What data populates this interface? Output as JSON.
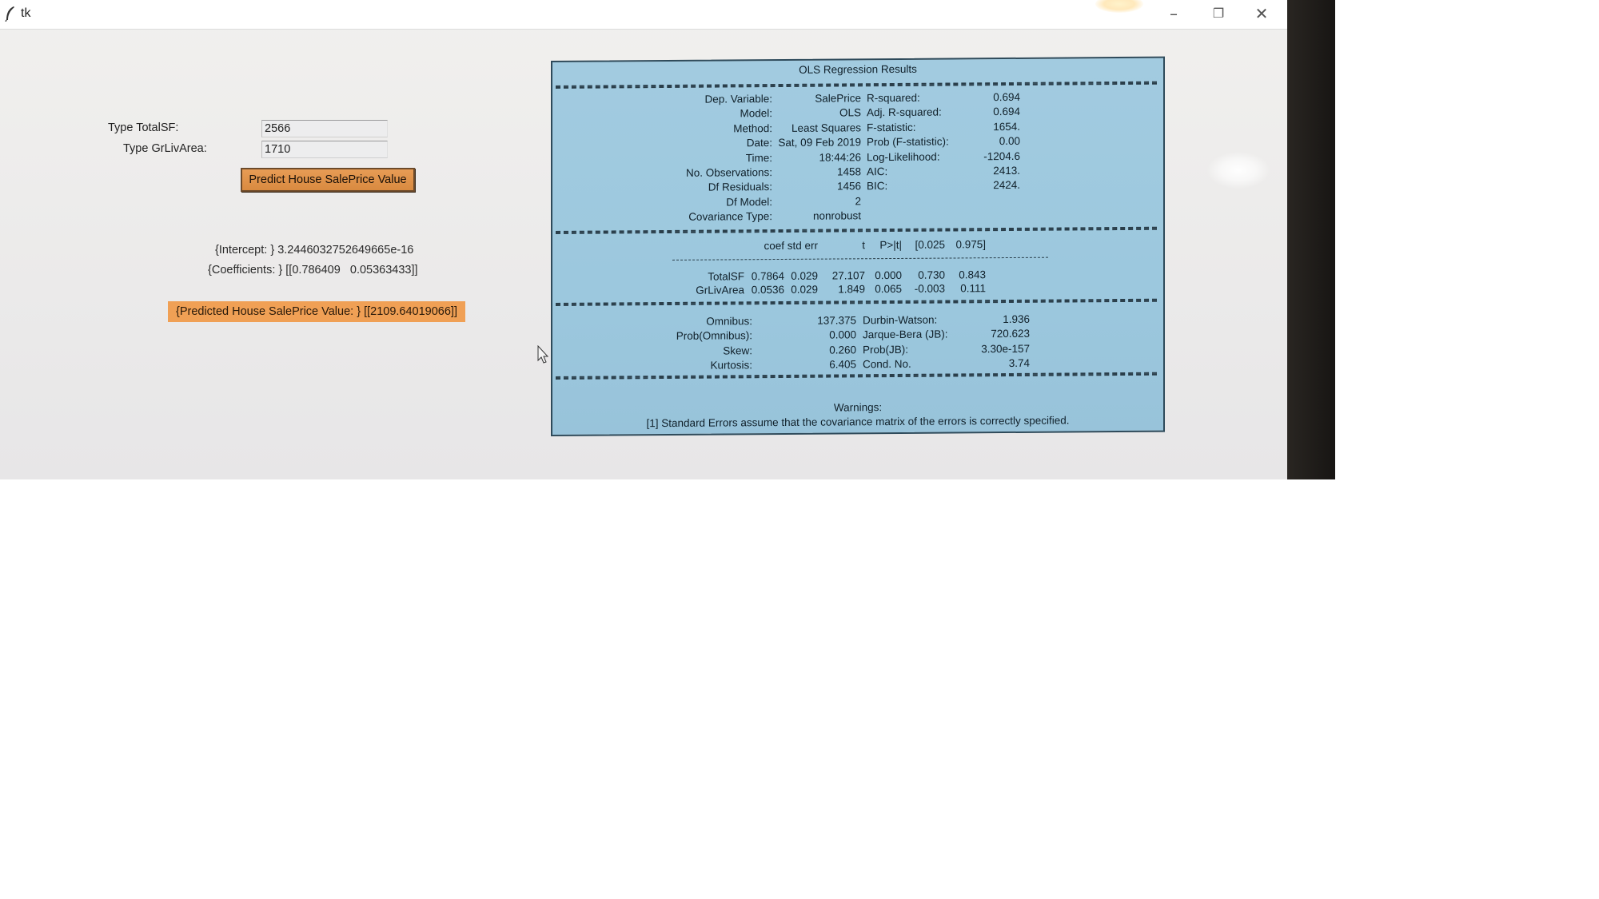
{
  "window": {
    "title": "tk",
    "minimize": "–",
    "restore": "❐",
    "close": "✕"
  },
  "form": {
    "totalsf_label": "Type TotalSF:",
    "totalsf_value": "2566",
    "grlivarea_label": "Type GrLivArea:",
    "grlivarea_value": "1710",
    "predict_button": "Predict House SalePrice Value"
  },
  "results": {
    "intercept": "{Intercept: } 3.2446032752649665e-16",
    "coefficients": "{Coefficients: } [[0.786409   0.05363433]]",
    "predicted": "{Predicted House SalePrice Value: } [[2109.64019066]]"
  },
  "ols": {
    "title": "OLS Regression Results",
    "header_rows": [
      {
        "l": "Dep. Variable:",
        "lv": "SalePrice",
        "r": "R-squared:",
        "rv": "0.694"
      },
      {
        "l": "Model:",
        "lv": "OLS",
        "r": "Adj. R-squared:",
        "rv": "0.694"
      },
      {
        "l": "Method:",
        "lv": "Least Squares",
        "r": "F-statistic:",
        "rv": "1654."
      },
      {
        "l": "Date:",
        "lv": "Sat, 09 Feb 2019",
        "r": "Prob (F-statistic):",
        "rv": "0.00"
      },
      {
        "l": "Time:",
        "lv": "18:44:26",
        "r": "Log-Likelihood:",
        "rv": "-1204.6"
      },
      {
        "l": "No. Observations:",
        "lv": "1458",
        "r": "AIC:",
        "rv": "2413."
      },
      {
        "l": "Df Residuals:",
        "lv": "1456",
        "r": "BIC:",
        "rv": "2424."
      },
      {
        "l": "Df Model:",
        "lv": "2",
        "r": "",
        "rv": ""
      },
      {
        "l": "Covariance Type:",
        "lv": "nonrobust",
        "r": "",
        "rv": ""
      }
    ],
    "coef_headers": [
      "coef",
      "std err",
      "t",
      "P>|t|",
      "[0.025",
      "0.975]"
    ],
    "coef_rows": [
      {
        "name": "TotalSF",
        "values": [
          "0.7864",
          "0.029",
          "27.107",
          "0.000",
          "0.730",
          "0.843"
        ]
      },
      {
        "name": "GrLivArea",
        "values": [
          "0.0536",
          "0.029",
          "1.849",
          "0.065",
          "-0.003",
          "0.111"
        ]
      }
    ],
    "diag_rows": [
      {
        "l": "Omnibus:",
        "lv": "137.375",
        "r": "Durbin-Watson:",
        "rv": "1.936"
      },
      {
        "l": "Prob(Omnibus):",
        "lv": "0.000",
        "r": "Jarque-Bera (JB):",
        "rv": "720.623"
      },
      {
        "l": "Skew:",
        "lv": "0.260",
        "r": "Prob(JB):",
        "rv": "3.30e-157"
      },
      {
        "l": "Kurtosis:",
        "lv": "6.405",
        "r": "Cond. No.",
        "rv": "3.74"
      }
    ],
    "warnings_title": "Warnings:",
    "warning_text": "[1] Standard Errors assume that the covariance matrix of the errors is correctly specified."
  },
  "colors": {
    "button": "#e0924a",
    "predicted_bg": "#f0a055",
    "ols_panel_bg": "#9ec8de"
  }
}
